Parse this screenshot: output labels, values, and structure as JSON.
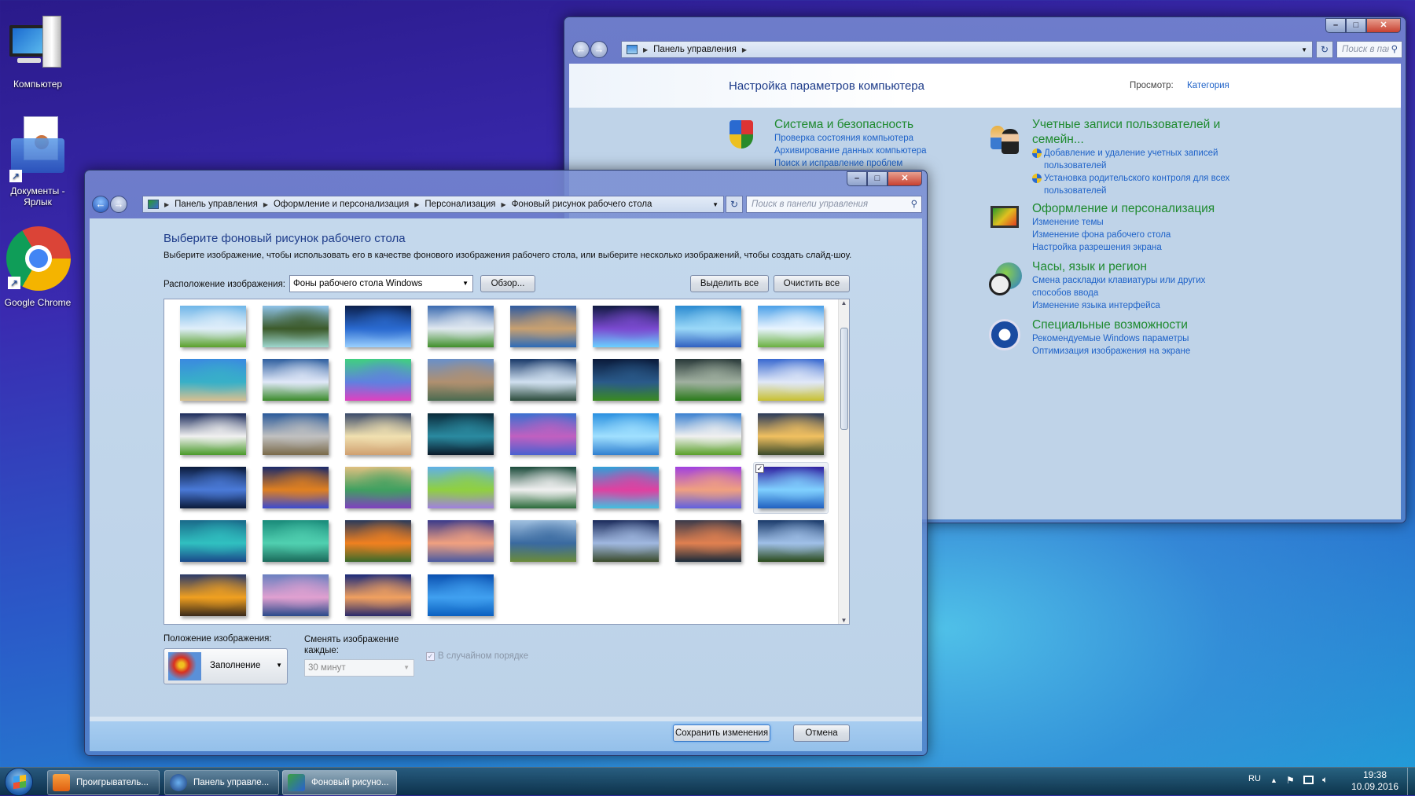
{
  "desktop": {
    "icons": [
      {
        "label": "Компьютер",
        "icon": "computer-icon"
      },
      {
        "label": "Документы -\nЯрлык",
        "label1": "Документы -",
        "label2": "Ярлык",
        "icon": "documents-shortcut-icon"
      },
      {
        "label": "Google Chrome",
        "icon": "chrome-icon"
      }
    ]
  },
  "back_window": {
    "breadcrumb": [
      "Панель управления"
    ],
    "search_placeholder": "Поиск в панели управления",
    "title": "Настройка параметров компьютера",
    "view_label": "Просмотр:",
    "view_value": "Категория",
    "categories": [
      {
        "heading": "Система и безопасность",
        "icon": "shield-icon",
        "links": [
          "Проверка состояния компьютера",
          "Архивирование данных компьютера",
          "Поиск и исправление проблем"
        ]
      },
      {
        "heading": "Учетные записи пользователей и семейн...",
        "heading1": "Учетные записи пользователей и",
        "heading2": "семейн...",
        "icon": "users-icon",
        "links": [
          "Добавление и удаление учетных записей пользователей",
          "Установка родительского контроля для всех пользователей"
        ]
      },
      {
        "heading": "Оформление и персонализация",
        "icon": "monitor-icon",
        "links": [
          "Изменение темы",
          "Изменение фона рабочего стола",
          "Настройка разрешения экрана"
        ]
      },
      {
        "heading": "Часы, язык и регион",
        "icon": "clock-globe-icon",
        "links": [
          "Смена раскладки клавиатуры или других способов ввода",
          "Изменение языка интерфейса"
        ]
      },
      {
        "heading": "Специальные возможности",
        "icon": "accessibility-icon",
        "links": [
          "Рекомендуемые Windows параметры",
          "Оптимизация изображения на экране"
        ]
      }
    ]
  },
  "front_window": {
    "breadcrumb": [
      "Панель управления",
      "Оформление и персонализация",
      "Персонализация",
      "Фоновый рисунок рабочего стола"
    ],
    "search_placeholder": "Поиск в панели управления",
    "title": "Выберите фоновый рисунок рабочего стола",
    "description": "Выберите изображение, чтобы использовать его в качестве фонового изображения рабочего стола, или выберите несколько изображений, чтобы создать слайд-шоу.",
    "location_label": "Расположение изображения:",
    "location_value": "Фоны рабочего стола Windows",
    "browse_label": "Обзор...",
    "select_all_label": "Выделить все",
    "clear_all_label": "Очистить все",
    "selected_index": 31,
    "thumbnails": [
      [
        "#6fb6e8",
        "#dfeefa",
        "#5aa02a"
      ],
      [
        "#8fc3ea",
        "#3c5a2a",
        "#9fd8d0"
      ],
      [
        "#0b1f4a",
        "#2a6ad0",
        "#9ad0ff"
      ],
      [
        "#3a6ab0",
        "#e0e8f0",
        "#3f8f2a"
      ],
      [
        "#2e5aa0",
        "#c8a070",
        "#2c6ab8"
      ],
      [
        "#101a40",
        "#7a4ad0",
        "#6ad0ff"
      ],
      [
        "#2a8ad0",
        "#9ad8f8",
        "#3060c0"
      ],
      [
        "#4aa0e8",
        "#e8f4ff",
        "#6ab040"
      ],
      [
        "#3a8ae0",
        "#38b0c8",
        "#d8c090"
      ],
      [
        "#3060a0",
        "#e0e8f8",
        "#3a8a2a"
      ],
      [
        "#40d080",
        "#6080e0",
        "#e040c0"
      ],
      [
        "#6a90c8",
        "#b09070",
        "#4a6a50"
      ],
      [
        "#1a3a6a",
        "#d0e0f0",
        "#2a4a3a"
      ],
      [
        "#0a1a3a",
        "#2a5a8a",
        "#3a8a20"
      ],
      [
        "#2a3a3a",
        "#a0b0a0",
        "#2a7a1a"
      ],
      [
        "#3a6ad0",
        "#e0e8f8",
        "#c8c030"
      ],
      [
        "#1a2a5a",
        "#f0f0f0",
        "#4a9a2a"
      ],
      [
        "#2a5a9a",
        "#c0c0c0",
        "#7a6a4a"
      ],
      [
        "#3a4a6a",
        "#f0e0b0",
        "#d0a070"
      ],
      [
        "#0a2a3a",
        "#2a8aa0",
        "#0a1a2a"
      ],
      [
        "#3a70d0",
        "#c060c0",
        "#4a60d0"
      ],
      [
        "#2a90e0",
        "#a0e0ff",
        "#3080d0"
      ],
      [
        "#3a80d0",
        "#f0f0f0",
        "#5aa02a"
      ],
      [
        "#2a3a5a",
        "#f0c060",
        "#3a4a2a"
      ],
      [
        "#0a1a3a",
        "#4a7ad8",
        "#0a1a3a"
      ],
      [
        "#1a2a6a",
        "#e08020",
        "#3a4ad0"
      ],
      [
        "#e0c080",
        "#40a060",
        "#8040c0"
      ],
      [
        "#60b0e8",
        "#90d040",
        "#a080e0"
      ],
      [
        "#1a4a3a",
        "#f0f0f0",
        "#2a6a3a"
      ],
      [
        "#30a0d8",
        "#e040a0",
        "#40c0e0"
      ],
      [
        "#a040e0",
        "#f0a080",
        "#6060e0"
      ],
      [
        "#3020a0",
        "#80d0ff",
        "#2060c0"
      ],
      [
        "#1a6a8a",
        "#30c0c0",
        "#1a4a8a"
      ],
      [
        "#1a8a7a",
        "#50d0b0",
        "#1a6a5a"
      ],
      [
        "#2a3a5a",
        "#f08020",
        "#3a6a2a"
      ],
      [
        "#3a3a8a",
        "#f0a080",
        "#4a5aa0"
      ],
      [
        "#a0c0e0",
        "#3a6aa0",
        "#6a8a3a"
      ],
      [
        "#1a2a5a",
        "#a0b8e0",
        "#3a4a2a"
      ],
      [
        "#3a3a4a",
        "#e08050",
        "#1a2a3a"
      ],
      [
        "#1a3a6a",
        "#a0c0e8",
        "#2a4a1a"
      ],
      [
        "#2a3a6a",
        "#f0a020",
        "#3a2a1a"
      ],
      [
        "#6a80c0",
        "#e0a0d0",
        "#2a4a8a"
      ],
      [
        "#1a2a7a",
        "#f0a060",
        "#2a2a6a"
      ],
      [
        "#0a50b0",
        "#40a0f0",
        "#0a60c0"
      ]
    ],
    "position_label": "Положение изображения:",
    "position_value": "Заполнение",
    "interval_label1": "Сменять изображение",
    "interval_label2": "каждые:",
    "interval_value": "30 минут",
    "shuffle_label": "В случайном порядке",
    "shuffle_checked": true,
    "save_label": "Сохранить изменения",
    "cancel_label": "Отмена"
  },
  "taskbar": {
    "items": [
      {
        "label": "Проигрыватель...",
        "icon": "media-player-icon"
      },
      {
        "label": "Панель управле...",
        "icon": "control-panel-icon"
      },
      {
        "label": "Фоновый рисуно...",
        "icon": "wallpaper-icon",
        "active": true
      }
    ],
    "language": "RU",
    "time": "19:38",
    "date": "10.09.2016"
  }
}
